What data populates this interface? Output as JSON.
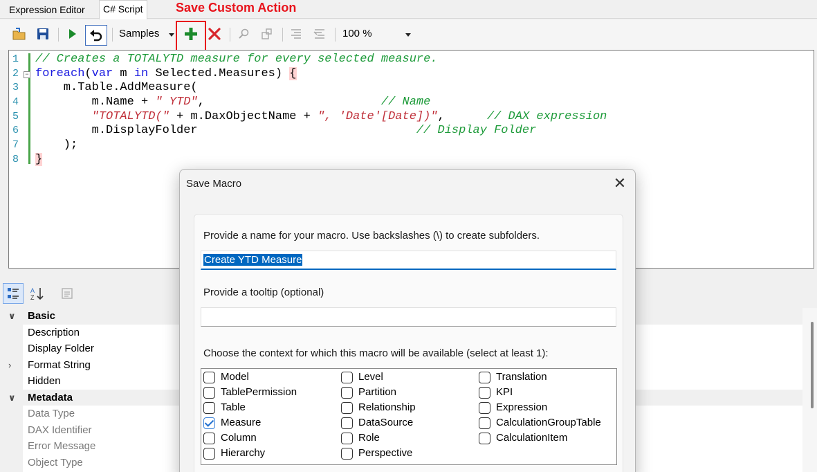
{
  "tabs": [
    {
      "label": "Expression Editor"
    },
    {
      "label": "C# Script"
    }
  ],
  "annotation": {
    "label": "Save Custom Action",
    "color": "#e8141c"
  },
  "toolbar": {
    "samples_label": "Samples",
    "zoom_value": "100 %",
    "icons": [
      "open-file-icon",
      "save-icon",
      "run-icon",
      "undo-icon",
      "add-icon",
      "delete-icon",
      "find-icon",
      "replace-icon",
      "comment-icon",
      "uncomment-icon"
    ]
  },
  "editor": {
    "lines": [
      {
        "num": "1"
      },
      {
        "num": "2"
      },
      {
        "num": "3"
      },
      {
        "num": "4"
      },
      {
        "num": "5"
      },
      {
        "num": "6"
      },
      {
        "num": "7"
      },
      {
        "num": "8"
      }
    ],
    "code": {
      "l1_comment": "// Creates a TOTALYTD measure for every selected measure.",
      "l2_kw1": "foreach",
      "l2_p1": "(",
      "l2_kw2": "var",
      "l2_p2": " m ",
      "l2_kw3": "in",
      "l2_p3": " Selected.Measures) ",
      "l2_brace": "{",
      "l3": "    m.Table.AddMeasure(",
      "l4_a": "        m.Name + ",
      "l4_str": "\" YTD\"",
      "l4_b": ",                         ",
      "l4_com": "// Name",
      "l5_a": "        ",
      "l5_str1": "\"TOTALYTD(\"",
      "l5_b": " + m.DaxObjectName + ",
      "l5_str2": "\", 'Date'[Date])\"",
      "l5_c": ",      ",
      "l5_com": "// DAX expression",
      "l6_a": "        m.DisplayFolder                               ",
      "l6_com": "// Display Folder",
      "l7": "    );",
      "l8_brace": "}"
    }
  },
  "property_grid": {
    "rows": [
      {
        "label": "Basic",
        "category": true,
        "chev": "∨"
      },
      {
        "label": "Description"
      },
      {
        "label": "Display Folder"
      },
      {
        "label": "Format String",
        "chev": "›"
      },
      {
        "label": "Hidden"
      },
      {
        "label": "Metadata",
        "category": true,
        "chev": "∨"
      },
      {
        "label": "Data Type",
        "dim": true
      },
      {
        "label": "DAX Identifier",
        "dim": true
      },
      {
        "label": "Error Message",
        "dim": true
      },
      {
        "label": "Object Type",
        "dim": true
      }
    ]
  },
  "dialog": {
    "title": "Save Macro",
    "close_glyph": "✕",
    "name_label": "Provide a name for your macro. Use backslashes (\\) to create subfolders.",
    "name_value": "Create YTD Measure",
    "tooltip_label": "Provide a tooltip (optional)",
    "tooltip_value": "",
    "context_label": "Choose the context for which this macro will be available (select at least 1):",
    "contexts": [
      {
        "label": "Model",
        "checked": false
      },
      {
        "label": "TablePermission",
        "checked": false
      },
      {
        "label": "Table",
        "checked": false
      },
      {
        "label": "Measure",
        "checked": true
      },
      {
        "label": "Column",
        "checked": false
      },
      {
        "label": "Hierarchy",
        "checked": false
      },
      {
        "label": "Level",
        "checked": false
      },
      {
        "label": "Partition",
        "checked": false
      },
      {
        "label": "Relationship",
        "checked": false
      },
      {
        "label": "DataSource",
        "checked": false
      },
      {
        "label": "Role",
        "checked": false
      },
      {
        "label": "Perspective",
        "checked": false
      },
      {
        "label": "Translation",
        "checked": false
      },
      {
        "label": "KPI",
        "checked": false
      },
      {
        "label": "Expression",
        "checked": false
      },
      {
        "label": "CalculationGroupTable",
        "checked": false
      },
      {
        "label": "CalculationItem",
        "checked": false
      }
    ]
  }
}
